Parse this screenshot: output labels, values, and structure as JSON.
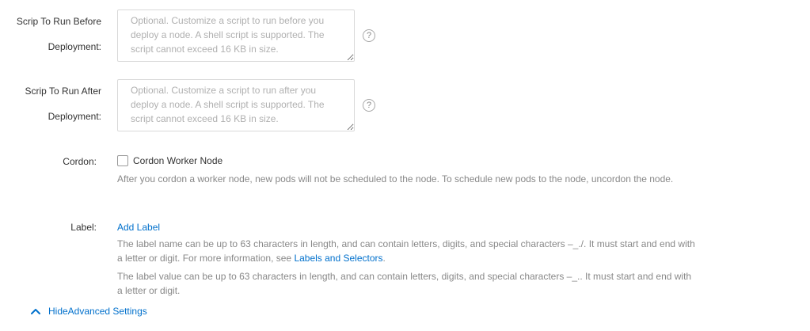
{
  "pre_script": {
    "label_line1": "Scrip To Run Before",
    "label_line2": "Deployment:",
    "placeholder": "Optional. Customize a script to run before you deploy a node. A shell script is supported. The script cannot exceed 16 KB in size."
  },
  "post_script": {
    "label_line1": "Scrip To Run After",
    "label_line2": "Deployment:",
    "placeholder": "Optional. Customize a script to run after you deploy a node. A shell script is supported. The script cannot exceed 16 KB in size."
  },
  "help_icon_glyph": "?",
  "cordon": {
    "label": "Cordon:",
    "checkbox_label": "Cordon Worker Node",
    "checked": false,
    "description": "After you cordon a worker node, new pods will not be scheduled to the node. To schedule new pods to the node, uncordon the node."
  },
  "label_section": {
    "label": "Label:",
    "add_label": "Add Label",
    "name_desc": "The label name can be up to 63 characters in length, and can contain letters, digits, and special characters –_./. It must start and end with a letter or digit. For more information, see ",
    "name_desc_link": "Labels and Selectors",
    "name_desc_end": ".",
    "value_desc": "The label value can be up to 63 characters in length, and can contain letters, digits, and special characters –_.. It must start and end with a letter or digit."
  },
  "advanced": {
    "toggle_label": "HideAdvanced Settings",
    "icon": "chevron-up-icon"
  },
  "colors": {
    "link": "#0070cc",
    "text": "#333333",
    "muted": "#888888",
    "placeholder": "#b0b0b0",
    "border": "#d9d9d9"
  }
}
